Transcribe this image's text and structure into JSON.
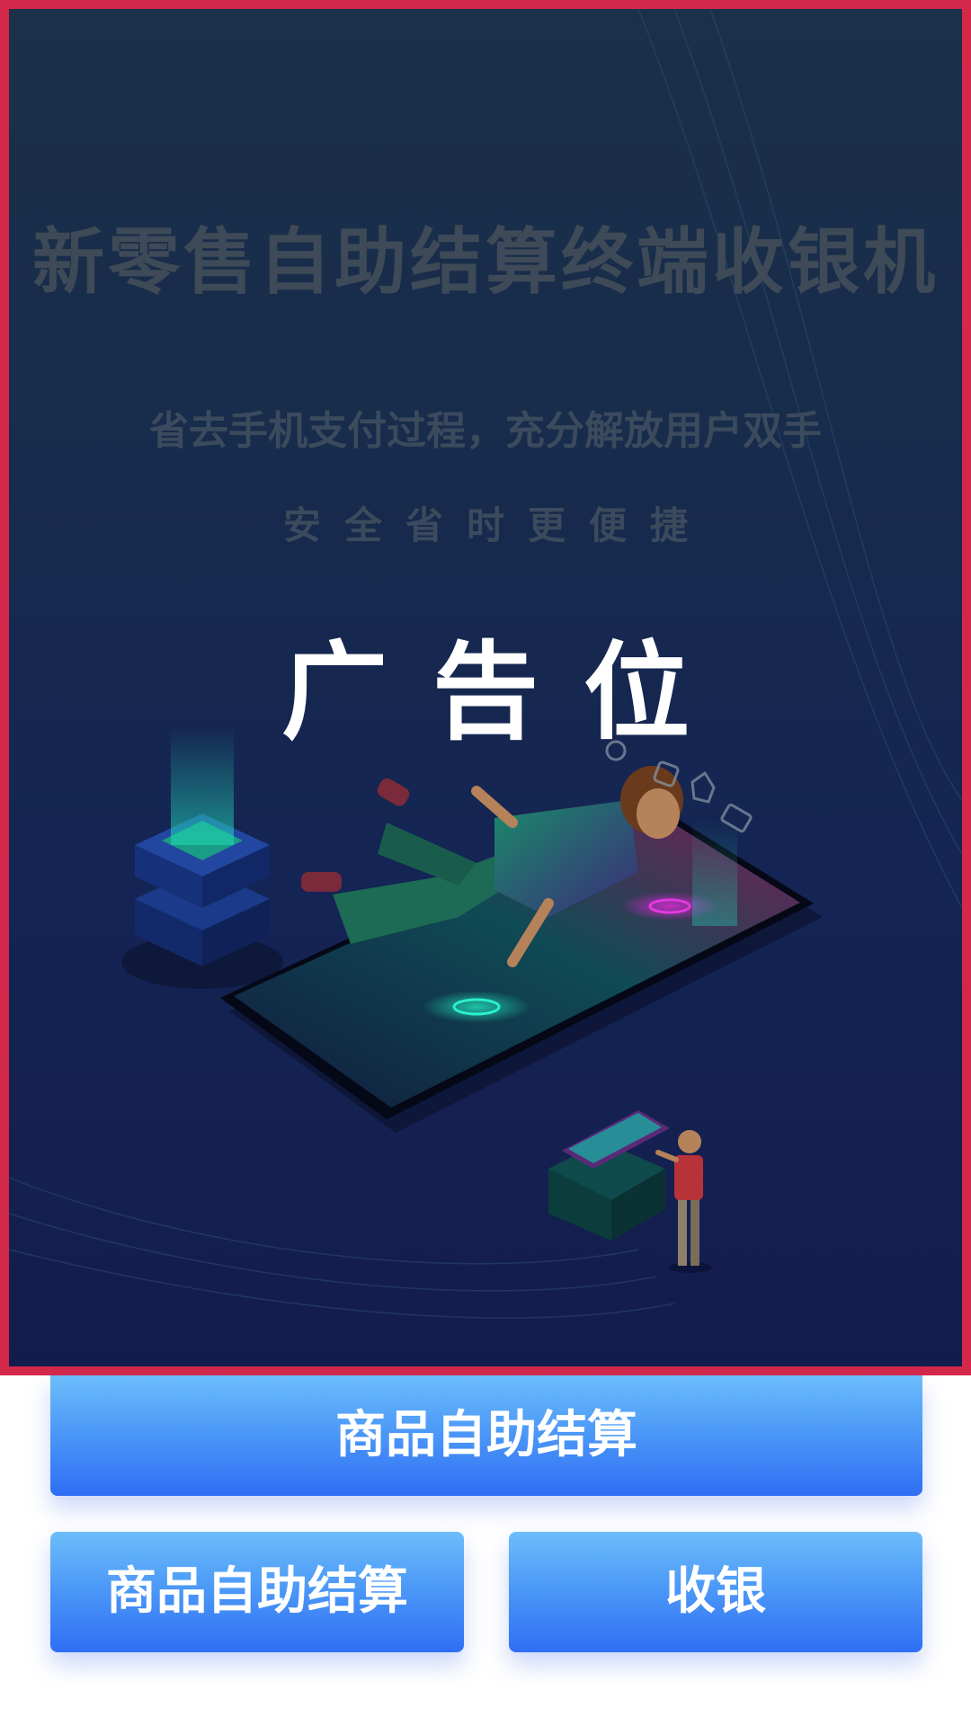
{
  "ad": {
    "headline": "新零售自助结算终端收银机",
    "subline": "省去手机支付过程，充分解放用户双手",
    "tagline": "安全省时更便捷",
    "placeholder": "广告位",
    "border_color": "#d4284a",
    "illustration": "person-floating-over-phone-illustration"
  },
  "actions": {
    "primary_label": "商品自助结算",
    "secondary_left_label": "商品自助结算",
    "secondary_right_label": "收银"
  }
}
